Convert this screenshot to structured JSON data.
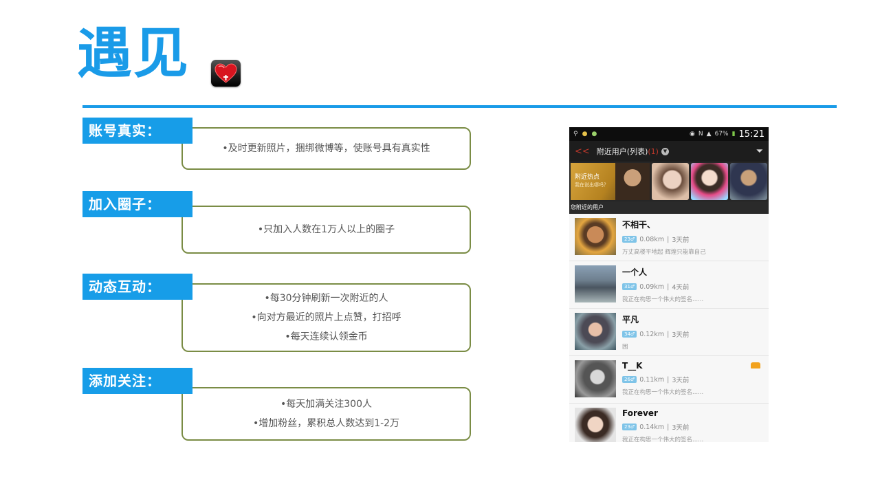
{
  "title": "遇见",
  "sections": [
    {
      "label": "账号真实：",
      "lines": [
        "•及时更新照片，捆绑微博等，使账号具有真实性"
      ]
    },
    {
      "label": "加入圈子：",
      "lines": [
        "•只加入人数在1万人以上的圈子"
      ]
    },
    {
      "label": "动态互动：",
      "lines": [
        "•每30分钟刷新一次附近的人",
        "•向对方最近的照片上点赞，打招呼",
        "•每天连续认领金币"
      ]
    },
    {
      "label": "添加关注：",
      "lines": [
        "•每天加满关注300人",
        "•增加粉丝，累积总人数达到1-2万"
      ]
    }
  ],
  "phone": {
    "status": {
      "battery": "67%",
      "time": "15:21"
    },
    "navbar": {
      "back": "<<",
      "title": "附近用户(列表)",
      "count": "(1)"
    },
    "banner": {
      "title": "附近热点",
      "subtitle": "我在说出哪吗？"
    },
    "section_header": "您附近的用户",
    "users": [
      {
        "name": "不相干、",
        "age": "23♂",
        "distance": "0.08km",
        "time": "3天前",
        "signature": "万丈高楼平地起    辉煌只能靠自己"
      },
      {
        "name": "一个人",
        "age": "31♂",
        "distance": "0.09km",
        "time": "4天前",
        "signature": "我正在构思一个伟大的签名......"
      },
      {
        "name": "平凡",
        "age": "34♂",
        "distance": "0.12km",
        "time": "3天前",
        "signature": "困"
      },
      {
        "name": "T__K",
        "age": "26♂",
        "distance": "0.11km",
        "time": "3天前",
        "signature": "我正在构思一个伟大的签名......"
      },
      {
        "name": "Forever",
        "age": "23♂",
        "distance": "0.14km",
        "time": "3天前",
        "signature": "我正在构思一个伟大的签名......"
      }
    ]
  },
  "colors": {
    "accent": "#1a9be8",
    "label_bg": "#179de8",
    "box_border": "#7a8c45"
  }
}
